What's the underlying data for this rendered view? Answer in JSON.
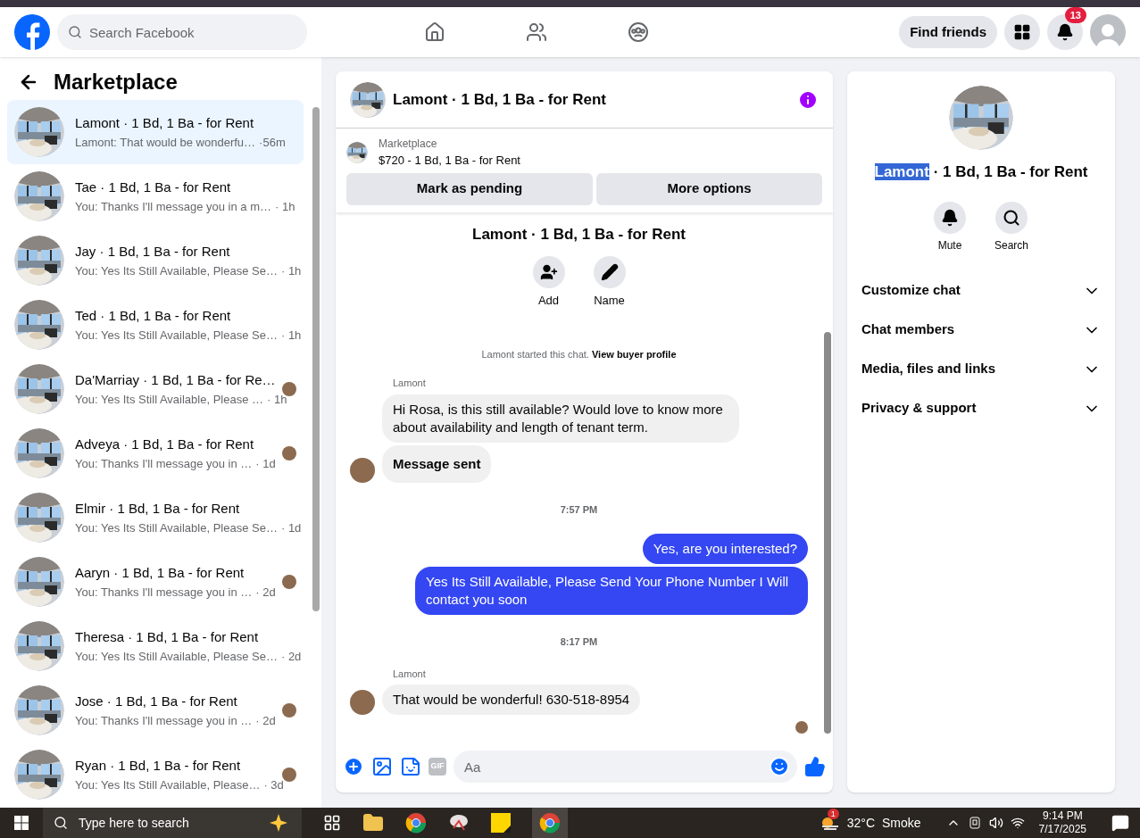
{
  "topbar": {
    "search_placeholder": "Search Facebook",
    "find_friends": "Find friends",
    "notifications_badge": "13"
  },
  "sidebar": {
    "title": "Marketplace",
    "conversations": [
      {
        "name": "Lamont · 1 Bd, 1 Ba - for Rent",
        "preview": "Lamont: That would be wonderfu…",
        "time": "·56m",
        "selected": true,
        "seen": false
      },
      {
        "name": "Tae · 1 Bd, 1 Ba - for Rent",
        "preview": "You: Thanks I'll message you in a m…",
        "time": "· 1h",
        "selected": false,
        "seen": false
      },
      {
        "name": "Jay · 1 Bd, 1 Ba - for Rent",
        "preview": "You: Yes Its Still Available, Please Se…",
        "time": "· 1h",
        "selected": false,
        "seen": false
      },
      {
        "name": "Ted · 1 Bd, 1 Ba - for Rent",
        "preview": "You: Yes Its Still Available, Please Se…",
        "time": "· 1h",
        "selected": false,
        "seen": false
      },
      {
        "name": "Da'Marriay · 1 Bd, 1 Ba - for Re…",
        "preview": "You: Yes Its Still Available, Please …",
        "time": "· 1h",
        "selected": false,
        "seen": true
      },
      {
        "name": "Adveya · 1 Bd, 1 Ba - for Rent",
        "preview": "You: Thanks I'll message you in …",
        "time": "· 1d",
        "selected": false,
        "seen": true
      },
      {
        "name": "Elmir · 1 Bd, 1 Ba - for Rent",
        "preview": "You: Yes Its Still Available, Please Se…",
        "time": "· 1d",
        "selected": false,
        "seen": false
      },
      {
        "name": "Aaryn · 1 Bd, 1 Ba - for Rent",
        "preview": "You: Thanks I'll message you in …",
        "time": "· 2d",
        "selected": false,
        "seen": true
      },
      {
        "name": "Theresa · 1 Bd, 1 Ba - for Rent",
        "preview": "You: Yes Its Still Available, Please Se…",
        "time": "· 2d",
        "selected": false,
        "seen": false
      },
      {
        "name": "Jose · 1 Bd, 1 Ba - for Rent",
        "preview": "You: Thanks I'll message you in …",
        "time": "· 2d",
        "selected": false,
        "seen": true
      },
      {
        "name": "Ryan · 1 Bd, 1 Ba - for Rent",
        "preview": "You: Yes Its Still Available, Please…",
        "time": "· 3d",
        "selected": false,
        "seen": true
      }
    ]
  },
  "chat": {
    "title": "Lamont · 1 Bd, 1 Ba - for Rent",
    "listing": {
      "source": "Marketplace",
      "summary": "$720 - 1 Bd, 1 Ba - for Rent",
      "buttons": [
        "Mark as pending",
        "More options"
      ]
    },
    "profile_title": "Lamont · 1 Bd, 1 Ba - for Rent",
    "profile_actions": [
      {
        "kind": "add",
        "label": "Add"
      },
      {
        "kind": "name",
        "label": "Name"
      }
    ],
    "notice": "Lamont started this chat. **View buyer profile**",
    "messages": [
      {
        "kind": "sender",
        "text": "Lamont"
      },
      {
        "kind": "incoming",
        "text": "Hi Rosa, is this still available? Would love to know more about availability and length of tenant term.",
        "avatar": false,
        "emphasis": false
      },
      {
        "kind": "incoming",
        "text": "Message sent",
        "avatar": true,
        "emphasis": true
      },
      {
        "kind": "timestamp",
        "text": "7:57 PM"
      },
      {
        "kind": "outgoing",
        "text": "Yes, are you interested?"
      },
      {
        "kind": "outgoing",
        "text": "Yes Its Still Available, Please Send Your Phone Number I Will contact you soon"
      },
      {
        "kind": "timestamp",
        "text": "8:17 PM"
      },
      {
        "kind": "sender",
        "text": "Lamont"
      },
      {
        "kind": "incoming",
        "text": "That would be wonderful! 630-518-8954",
        "avatar": true,
        "emphasis": false
      },
      {
        "kind": "seen"
      }
    ],
    "composer_placeholder": "Aa",
    "gif_label": "GIF"
  },
  "details": {
    "title_highlighted": "Lamont",
    "title_rest": " · 1 Bd, 1 Ba - for Rent",
    "actions": [
      {
        "kind": "mute",
        "label": "Mute"
      },
      {
        "kind": "search",
        "label": "Search"
      }
    ],
    "sections": [
      {
        "label": "Customize chat",
        "expanded": false
      },
      {
        "label": "Chat members",
        "expanded": false
      },
      {
        "label": "Media, files and links",
        "expanded": false
      },
      {
        "label": "Privacy & support",
        "expanded": false
      }
    ]
  },
  "taskbar": {
    "search_placeholder": "Type here to search",
    "weather_badge": "1",
    "temperature": "32°C",
    "condition": "Smoke",
    "time": "9:14 PM",
    "date": "7/17/2025"
  }
}
